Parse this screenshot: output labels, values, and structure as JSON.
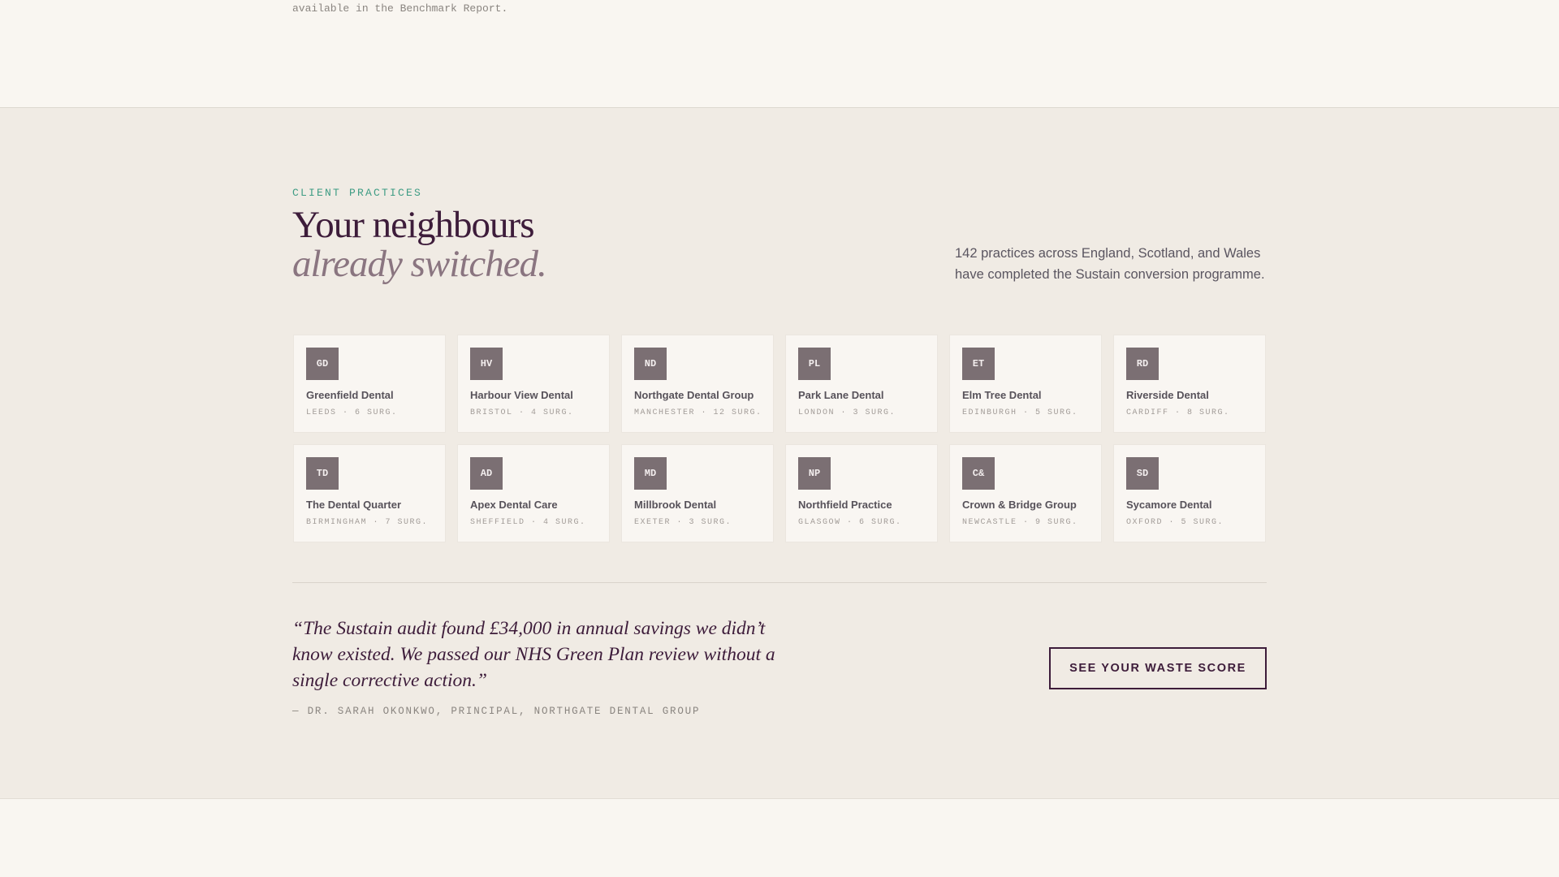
{
  "top_note": "available in the Benchmark Report.",
  "section": {
    "eyebrow": "CLIENT PRACTICES",
    "headline_line1": "Your neighbours",
    "headline_line2": "already switched.",
    "intro": "142 practices across England, Scotland, and Wales have completed the Sustain conversion programme."
  },
  "practices": [
    {
      "initials": "GD",
      "name": "Greenfield Dental",
      "meta": "LEEDS · 6 SURG."
    },
    {
      "initials": "HV",
      "name": "Harbour View Dental",
      "meta": "BRISTOL · 4 SURG."
    },
    {
      "initials": "ND",
      "name": "Northgate Dental Group",
      "meta": "MANCHESTER · 12 SURG."
    },
    {
      "initials": "PL",
      "name": "Park Lane Dental",
      "meta": "LONDON · 3 SURG."
    },
    {
      "initials": "ET",
      "name": "Elm Tree Dental",
      "meta": "EDINBURGH · 5 SURG."
    },
    {
      "initials": "RD",
      "name": "Riverside Dental",
      "meta": "CARDIFF · 8 SURG."
    },
    {
      "initials": "TD",
      "name": "The Dental Quarter",
      "meta": "BIRMINGHAM · 7 SURG."
    },
    {
      "initials": "AD",
      "name": "Apex Dental Care",
      "meta": "SHEFFIELD · 4 SURG."
    },
    {
      "initials": "MD",
      "name": "Millbrook Dental",
      "meta": "EXETER · 3 SURG."
    },
    {
      "initials": "NP",
      "name": "Northfield Practice",
      "meta": "GLASGOW · 6 SURG."
    },
    {
      "initials": "C&",
      "name": "Crown & Bridge Group",
      "meta": "NEWCASTLE · 9 SURG."
    },
    {
      "initials": "SD",
      "name": "Sycamore Dental",
      "meta": "OXFORD · 5 SURG."
    }
  ],
  "testimonial": {
    "quote": "“The Sustain audit found £34,000 in annual savings we didn’t know existed. We passed our NHS Green Plan review without a single corrective action.”",
    "attribution": "— DR. SARAH OKONKWO, PRINCIPAL, NORTHGATE DENTAL GROUP"
  },
  "cta": {
    "label": "SEE YOUR WASTE SCORE"
  },
  "colors": {
    "accent": "#3e9c84",
    "brand": "#3d1c3a",
    "badge": "#7b6f73"
  }
}
